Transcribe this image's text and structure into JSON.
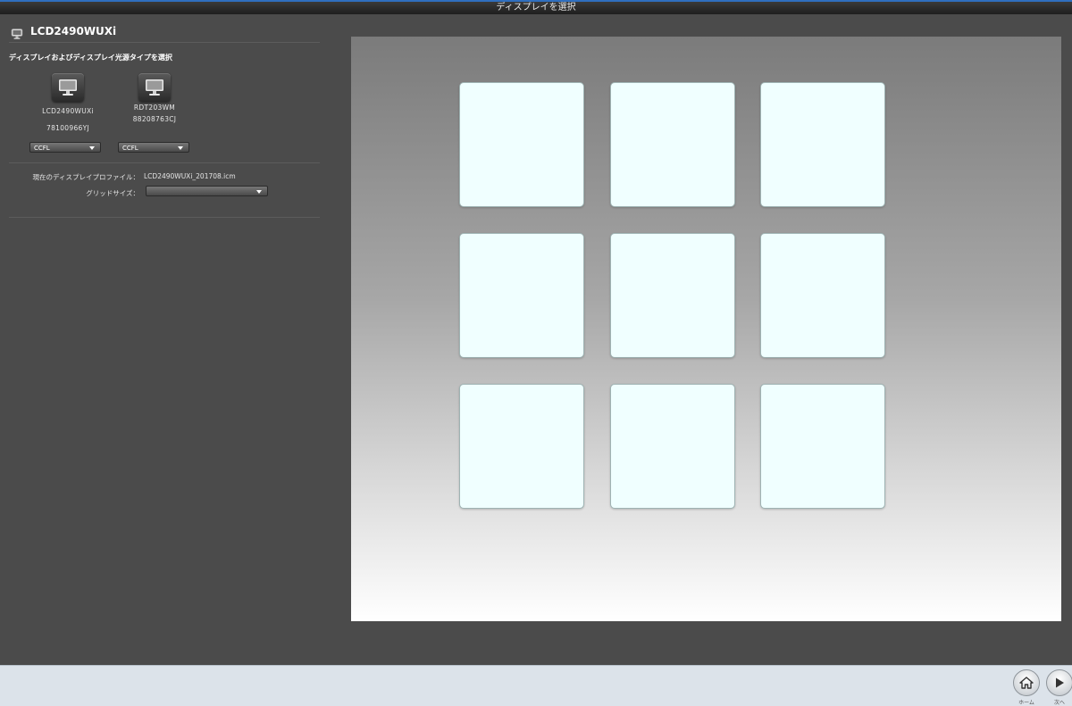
{
  "window": {
    "title": "ディスプレイを選択"
  },
  "sidebar": {
    "current_display": "LCD2490WUXi",
    "section_title": "ディスプレイおよびディスプレイ光源タイプを選択",
    "displays": [
      {
        "model": "LCD2490WUXi",
        "serial": "78100966YJ",
        "backlight": "CCFL"
      },
      {
        "model": "RDT203WM",
        "serial": "88208763CJ",
        "backlight": "CCFL"
      }
    ],
    "profile_label": "現在のディスプレイプロファイル：",
    "profile_value": "LCD2490WUXi_201708.icm",
    "grid_size_label": "グリッドサイズ：",
    "grid_size_value": ""
  },
  "preview": {
    "tile_count": 9,
    "tile_color": "#f0ffff"
  },
  "footer": {
    "home_label": "ホーム",
    "next_label": "次へ"
  }
}
